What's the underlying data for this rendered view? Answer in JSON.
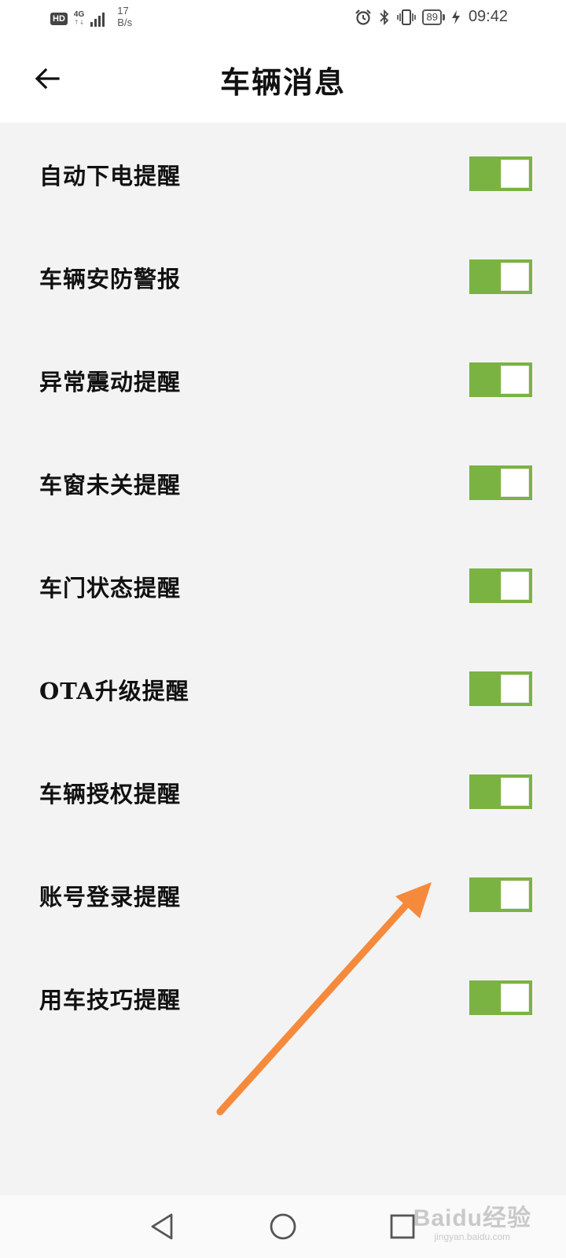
{
  "status_bar": {
    "hd": "HD",
    "network": "4G",
    "net_arrows": "↑↓",
    "speed_value": "17",
    "speed_unit": "B/s",
    "battery": "89",
    "time": "09:42",
    "icons": [
      "alarm-icon",
      "bluetooth-icon",
      "vibrate-icon",
      "charging-icon"
    ]
  },
  "header": {
    "title": "车辆消息",
    "back_icon": "back-arrow-icon"
  },
  "settings": [
    {
      "label": "自动下电提醒",
      "enabled": true
    },
    {
      "label": "车辆安防警报",
      "enabled": true
    },
    {
      "label": "异常震动提醒",
      "enabled": true
    },
    {
      "label": "车窗未关提醒",
      "enabled": true
    },
    {
      "label": "车门状态提醒",
      "enabled": true
    },
    {
      "label": "OTA升级提醒",
      "enabled": true
    },
    {
      "label": "车辆授权提醒",
      "enabled": true
    },
    {
      "label": "账号登录提醒",
      "enabled": true
    },
    {
      "label": "用车技巧提醒",
      "enabled": true
    }
  ],
  "colors": {
    "toggle_on": "#7bb342",
    "annotation_arrow": "#f58a3c",
    "background": "#f3f3f3"
  },
  "watermark": {
    "brand": "Baidu经验",
    "url": "jingyan.baidu.com"
  },
  "nav_bar": {
    "icons": [
      "nav-back-icon",
      "nav-home-icon",
      "nav-recents-icon"
    ]
  }
}
